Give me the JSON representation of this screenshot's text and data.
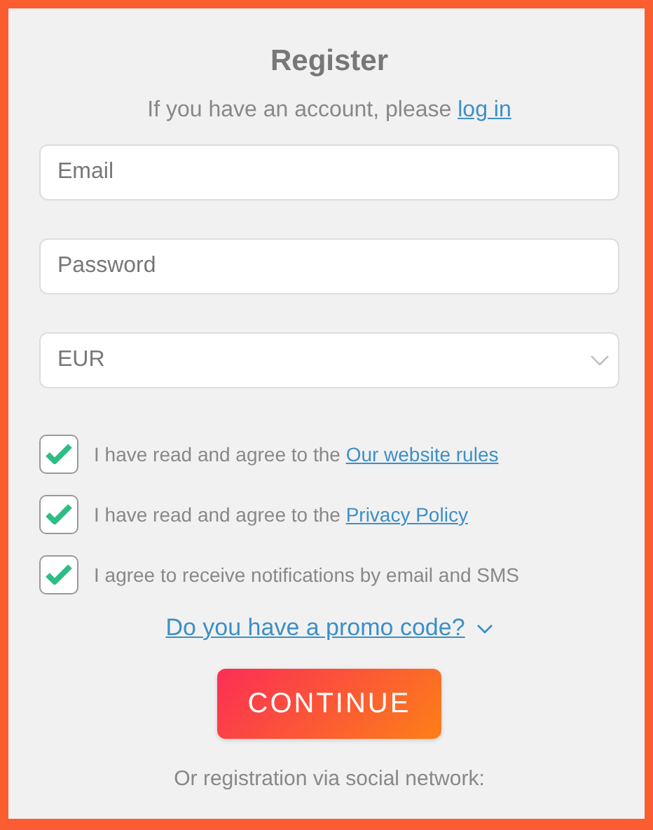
{
  "title": "Register",
  "login_prompt": {
    "text": "If you have an account, please ",
    "link": "log in"
  },
  "fields": [
    {
      "kind": "input",
      "placeholder": "Email"
    },
    {
      "kind": "input",
      "placeholder": "Password"
    },
    {
      "kind": "select",
      "value": "EUR"
    }
  ],
  "checkboxes": [
    {
      "text": "I have read and agree to the ",
      "link": "Our website rules",
      "checked": true
    },
    {
      "text": "I have read and agree to the ",
      "link": "Privacy Policy",
      "checked": true
    },
    {
      "text": "I agree to receive notifications by email and SMS",
      "checked": true
    }
  ],
  "promo_link": "Do you have a promo code?",
  "continue_button": "CONTINUE",
  "social_text": "Or registration via social network:"
}
